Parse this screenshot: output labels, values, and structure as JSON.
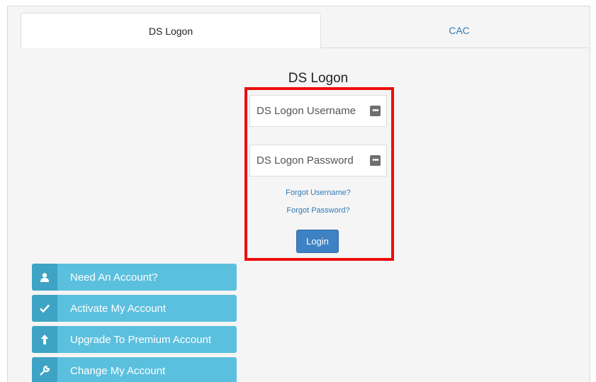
{
  "tabs": [
    {
      "label": "DS Logon",
      "active": true
    },
    {
      "label": "CAC",
      "active": false
    }
  ],
  "login_panel": {
    "title": "DS Logon",
    "username_placeholder": "DS Logon Username",
    "password_placeholder": "DS Logon Password",
    "forgot_username": "Forgot Username?",
    "forgot_password": "Forgot Password?",
    "login_label": "Login"
  },
  "side_buttons": [
    {
      "label": "Need An Account?",
      "icon": "user-icon"
    },
    {
      "label": "Activate My Account",
      "icon": "checkmark-icon"
    },
    {
      "label": "Upgrade To Premium Account",
      "icon": "arrow-up-icon"
    },
    {
      "label": "Change My Account",
      "icon": "wrench-icon"
    }
  ],
  "colors": {
    "highlight": "#ee0d0d",
    "primary": "#3f82c4",
    "info": "#5bc0de",
    "link": "#337ab7"
  }
}
